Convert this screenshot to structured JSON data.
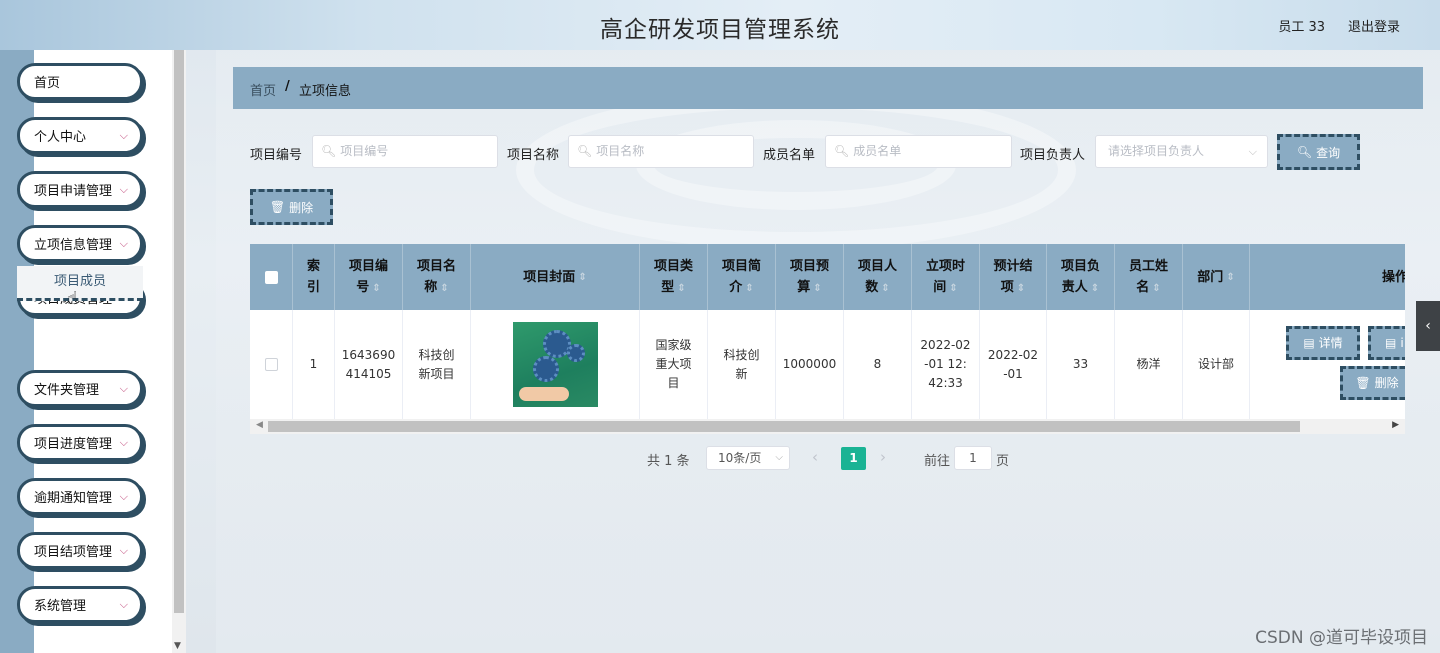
{
  "header": {
    "app_title": "高企研发项目管理系统",
    "user_label": "员工 33",
    "logout_label": "退出登录"
  },
  "sidebar": {
    "items": [
      {
        "label": "首页",
        "has_arrow": false
      },
      {
        "label": "个人中心",
        "has_arrow": true
      },
      {
        "label": "项目申请管理",
        "has_arrow": true
      },
      {
        "label": "立项信息管理",
        "has_arrow": true
      },
      {
        "label": "项目成员管理",
        "has_arrow": true
      },
      {
        "label": "文件夹管理",
        "has_arrow": true
      },
      {
        "label": "项目进度管理",
        "has_arrow": true
      },
      {
        "label": "逾期通知管理",
        "has_arrow": true
      },
      {
        "label": "项目结项管理",
        "has_arrow": true
      },
      {
        "label": "系统管理",
        "has_arrow": true
      }
    ],
    "submenu_item": "项目成员"
  },
  "breadcrumb": {
    "home": "首页",
    "separator": "/",
    "current": "立项信息"
  },
  "search": {
    "project_no_label": "项目编号",
    "project_no_placeholder": "项目编号",
    "project_name_label": "项目名称",
    "project_name_placeholder": "项目名称",
    "members_label": "成员名单",
    "members_placeholder": "成员名单",
    "leader_label": "项目负责人",
    "leader_placeholder": "请选择项目负责人",
    "query_button": "查询",
    "delete_button": "删除"
  },
  "table": {
    "headers": [
      {
        "line1": "索",
        "line2": "引",
        "sortable": false
      },
      {
        "line1": "项目编",
        "line2": "号",
        "sortable": true
      },
      {
        "line1": "项目名",
        "line2": "称",
        "sortable": true
      },
      {
        "line1": "项目封面",
        "line2": "",
        "sortable": true
      },
      {
        "line1": "项目类",
        "line2": "型",
        "sortable": true
      },
      {
        "line1": "项目简",
        "line2": "介",
        "sortable": true
      },
      {
        "line1": "项目预",
        "line2": "算",
        "sortable": true
      },
      {
        "line1": "项目人",
        "line2": "数",
        "sortable": true
      },
      {
        "line1": "立项时",
        "line2": "间",
        "sortable": true
      },
      {
        "line1": "预计结",
        "line2": "项",
        "sortable": true
      },
      {
        "line1": "项目负",
        "line2": "责人",
        "sortable": true
      },
      {
        "line1": "员工姓",
        "line2": "名",
        "sortable": true
      },
      {
        "line1": "部门",
        "line2": "",
        "sortable": true
      },
      {
        "line1": "操作",
        "line2": "",
        "sortable": false
      }
    ],
    "rows": [
      {
        "index": "1",
        "project_no_l1": "1643690",
        "project_no_l2": "414105",
        "project_name_l1": "科技创",
        "project_name_l2": "新项目",
        "type_l1": "国家级",
        "type_l2": "重大项",
        "type_l3": "目",
        "intro_l1": "科技创",
        "intro_l2": "新",
        "budget": "1000000",
        "headcount": "8",
        "start_l1": "2022-02",
        "start_l2": "-01 12:",
        "start_l3": "42:33",
        "end_l1": "2022-02",
        "end_l2": "-01",
        "leader": "33",
        "employee": "杨洋",
        "department": "设计部"
      }
    ],
    "actions": {
      "detail": "详情",
      "edit_partial": "i",
      "delete": "删除"
    }
  },
  "pagination": {
    "total": "共 1 条",
    "page_size": "10条/页",
    "current_page": "1",
    "goto_label": "前往",
    "goto_value": "1",
    "page_suffix": "页"
  },
  "watermark": "CSDN @道可毕设项目",
  "colors": {
    "accent": "#8aabc3",
    "border_dark": "#2e4e62",
    "pager_active": "#1ab394"
  }
}
